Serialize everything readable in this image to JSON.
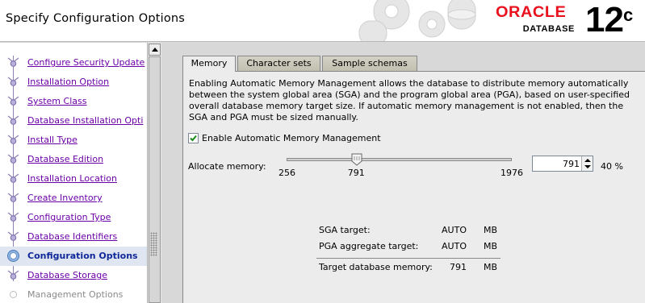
{
  "header": {
    "title": "Specify Configuration Options",
    "brand": "ORACLE",
    "product": "DATABASE",
    "version": "12",
    "version_suffix": "c",
    "brand_color": "#e8111d"
  },
  "sidebar": {
    "items": [
      {
        "label": "Configure Security Update",
        "state": "done"
      },
      {
        "label": "Installation Option",
        "state": "done"
      },
      {
        "label": "System Class",
        "state": "done"
      },
      {
        "label": "Database Installation Opti",
        "state": "done"
      },
      {
        "label": "Install Type",
        "state": "done"
      },
      {
        "label": "Database Edition",
        "state": "done"
      },
      {
        "label": "Installation Location",
        "state": "done"
      },
      {
        "label": "Create Inventory",
        "state": "done"
      },
      {
        "label": "Configuration Type",
        "state": "done"
      },
      {
        "label": "Database Identifiers",
        "state": "done"
      },
      {
        "label": "Configuration Options",
        "state": "current"
      },
      {
        "label": "Database Storage",
        "state": "done"
      },
      {
        "label": "Management Options",
        "state": "future"
      }
    ]
  },
  "tabs": [
    {
      "label": "Memory",
      "active": true
    },
    {
      "label": "Character sets",
      "active": false
    },
    {
      "label": "Sample schemas",
      "active": false
    }
  ],
  "memory": {
    "description": "Enabling Automatic Memory Management allows the database to distribute memory automatically between the system global area (SGA) and the program global area (PGA), based on user-specified overall database memory target size. If automatic memory management is not enabled, then the SGA and PGA must be sized manually.",
    "enable_amm_label": "Enable Automatic Memory Management",
    "enable_amm_checked": true,
    "allocate_label": "Allocate memory:",
    "slider_min": "256",
    "slider_value": "791",
    "slider_max": "1976",
    "spinner_value": "791",
    "percent": "40 %",
    "summary": {
      "sga_label": "SGA target:",
      "sga_value": "AUTO",
      "sga_unit": "MB",
      "pga_label": "PGA aggregate target:",
      "pga_value": "AUTO",
      "pga_unit": "MB",
      "total_label": "Target database memory:",
      "total_value": "791",
      "total_unit": "MB"
    }
  }
}
